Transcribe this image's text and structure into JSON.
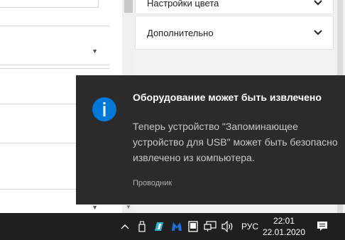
{
  "right_panel": {
    "items": [
      {
        "label": "Настройки цвета"
      },
      {
        "label": "Дополнительно"
      }
    ]
  },
  "toast": {
    "icon": "info-icon",
    "accent_color": "#0078d7",
    "title": "Оборудование может быть извлечено",
    "body": "Теперь устройство \"Запоминающее устройство для USB\" может быть безопасно извлечено из компьютера.",
    "source": "Проводник"
  },
  "taskbar": {
    "tray_icons": [
      "chevron-up-icon",
      "usb-drive-icon",
      "app-icon",
      "malwarebytes-icon",
      "tablet-icon",
      "network-icon",
      "volume-icon"
    ],
    "language": "РУС",
    "time": "22:01",
    "date": "22.01.2020",
    "notification_icon": "action-center-icon"
  }
}
